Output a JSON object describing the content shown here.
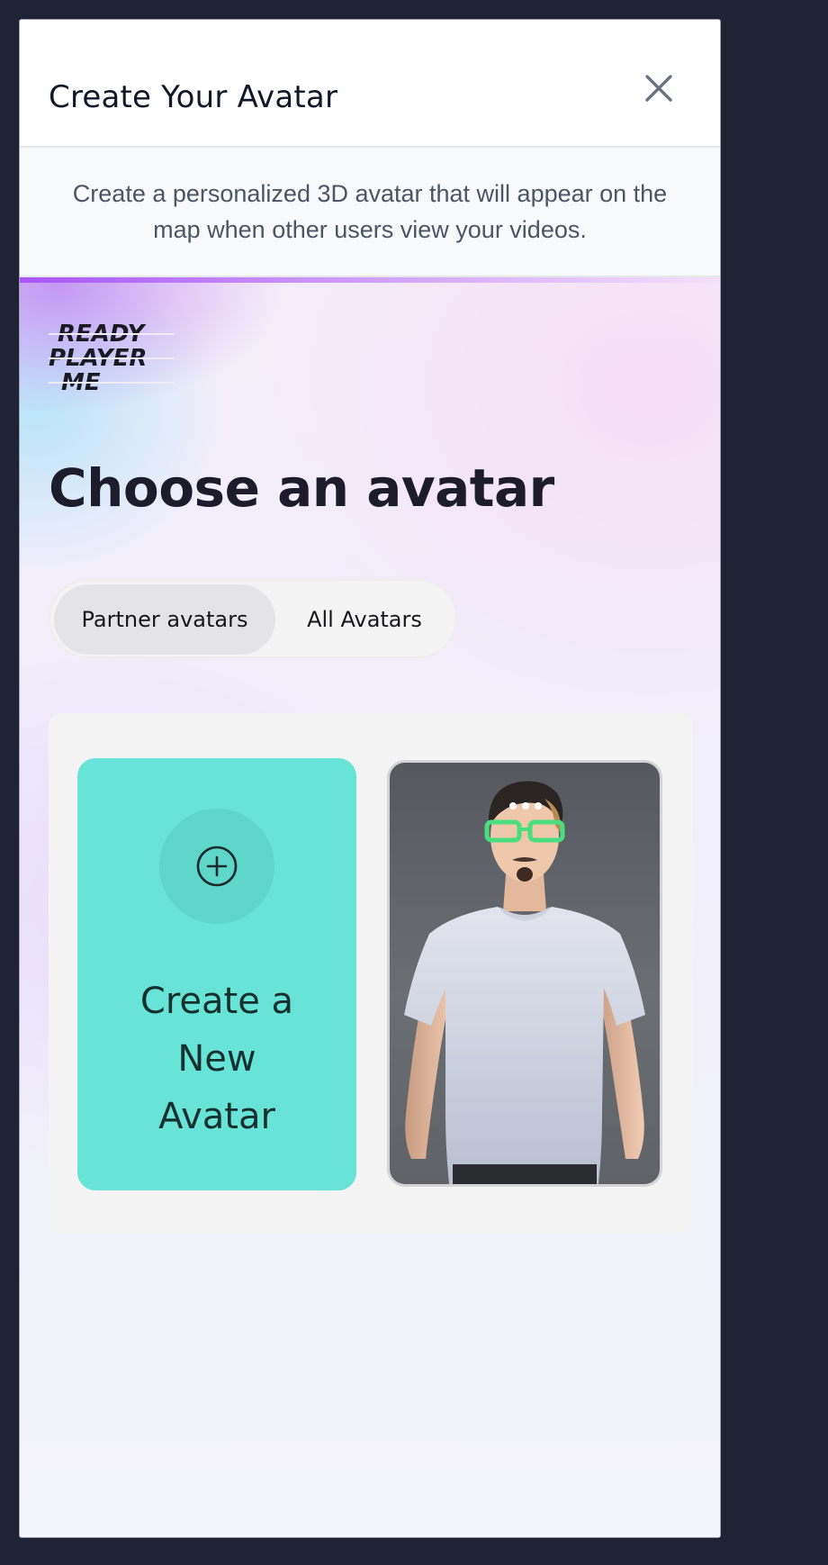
{
  "modal": {
    "title": "Create Your Avatar",
    "description": "Create a personalized 3D avatar that will appear on the map when other users view your videos."
  },
  "rpm": {
    "logo_text": [
      "READY",
      "PLAYER",
      "ME"
    ],
    "heading": "Choose an avatar",
    "tabs": [
      {
        "label": "Partner avatars",
        "active": true
      },
      {
        "label": "All Avatars",
        "active": false
      }
    ],
    "create_card": {
      "label_lines": [
        "Create a",
        "New",
        "Avatar"
      ],
      "icon": "plus-circle-icon",
      "color": "#67e4d7"
    },
    "avatar_card": {
      "icon": "more-dots-icon"
    }
  }
}
